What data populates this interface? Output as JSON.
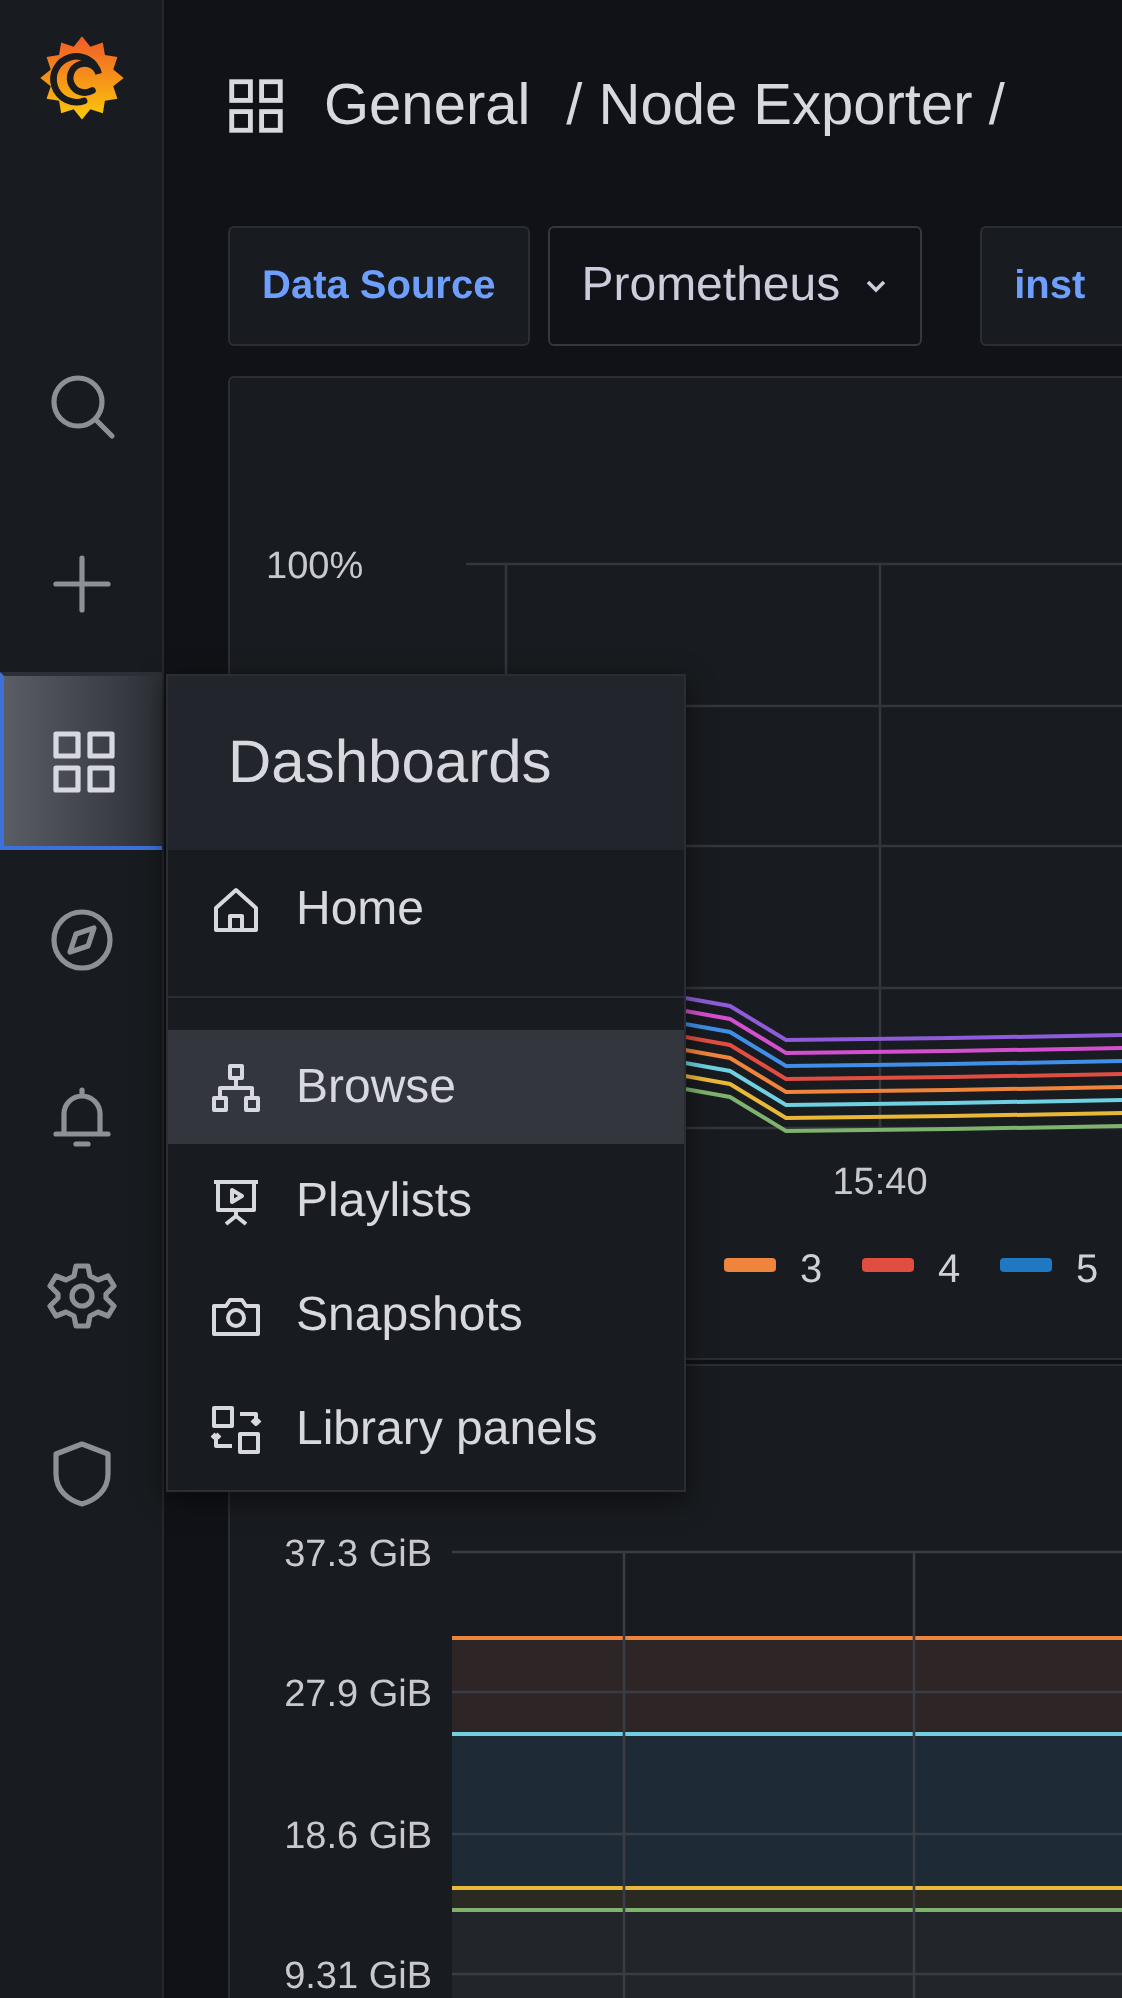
{
  "sidebar": {
    "items": [
      {
        "selected": false
      },
      {
        "selected": false
      },
      {
        "selected": true
      },
      {
        "selected": false
      },
      {
        "selected": false
      },
      {
        "selected": false
      },
      {
        "selected": false
      }
    ]
  },
  "header": {
    "breadcrumb": [
      "General",
      "/ Node Exporter /"
    ]
  },
  "variables": [
    {
      "kind": "label",
      "text": "Data Source"
    },
    {
      "kind": "select",
      "text": "Prometheus"
    },
    {
      "kind": "label",
      "text": "inst"
    }
  ],
  "panels": [
    {
      "kind": "lines",
      "y_ticks": [
        "100%"
      ],
      "x_ticks": [
        "15:40"
      ],
      "legend": [
        {
          "label": "3",
          "color": "#ef843c"
        },
        {
          "label": "4",
          "color": "#e24d42"
        },
        {
          "label": "5",
          "color": "#1f78c1"
        }
      ]
    },
    {
      "kind": "areas",
      "y_ticks": [
        "37.3 GiB",
        "27.9 GiB",
        "18.6 GiB",
        "9.31 GiB"
      ]
    }
  ],
  "menu": {
    "title": "Dashboards",
    "items": [
      {
        "label": "Home",
        "selected": false
      },
      {
        "label": "Browse",
        "selected": true
      },
      {
        "label": "Playlists",
        "selected": false
      },
      {
        "label": "Snapshots",
        "selected": false
      },
      {
        "label": "Library panels",
        "selected": false
      }
    ]
  }
}
